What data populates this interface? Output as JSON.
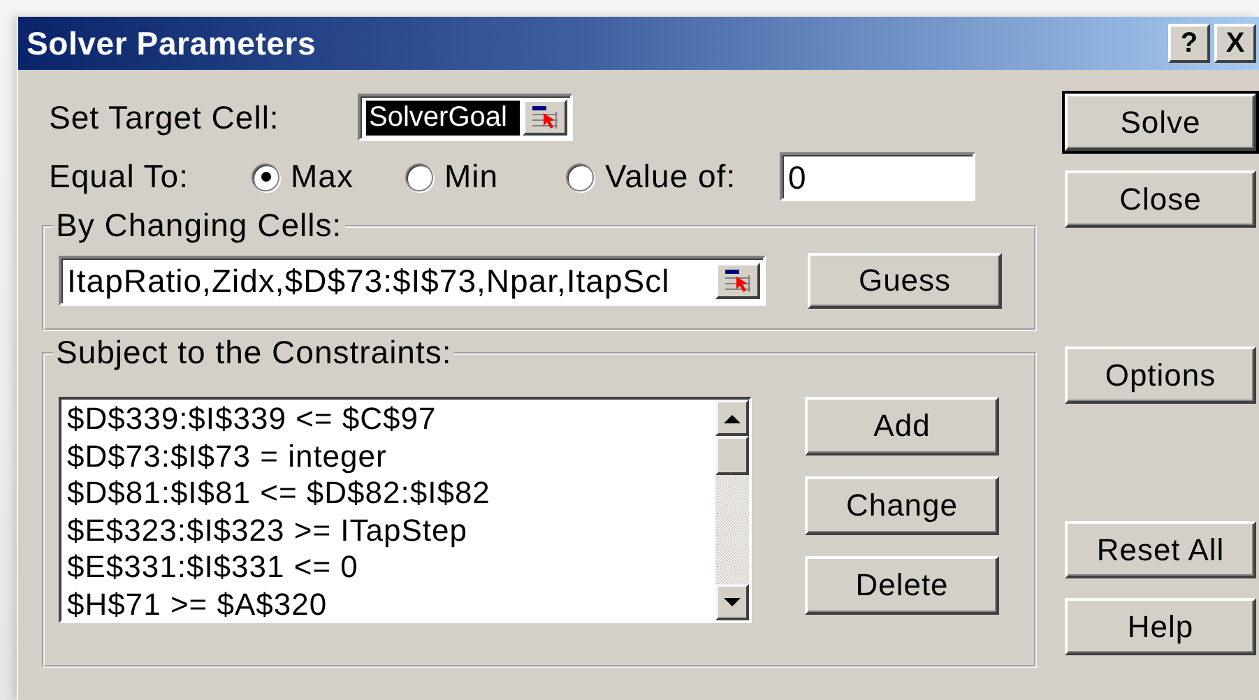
{
  "window": {
    "title": "Solver Parameters",
    "title_buttons": [
      "?",
      "X"
    ]
  },
  "target_cell": {
    "label": "Set Target Cell:",
    "value": "SolverGoal",
    "highlighted": true
  },
  "equal_to": {
    "label": "Equal To:",
    "options": [
      {
        "label": "Max",
        "selected": true
      },
      {
        "label": "Min",
        "selected": false
      },
      {
        "label": "Value of:",
        "selected": false
      }
    ],
    "value": "0"
  },
  "changing_cells": {
    "label": "By Changing Cells:",
    "value": "ItapRatio,Zidx,$D$73:$I$73,Npar,ItapScl",
    "button": {
      "label": "Guess"
    }
  },
  "constraints": {
    "label": "Subject to the Constraints:",
    "items": [
      "$D$339:$I$339 <= $C$97",
      "$D$73:$I$73 = integer",
      "$D$81:$I$81 <= $D$82:$I$82",
      "$E$323:$I$323 >= ITapStep",
      "$E$331:$I$331 <= 0",
      "$H$71 >= $A$320"
    ],
    "buttons": [
      {
        "label": "Add"
      },
      {
        "label": "Change"
      },
      {
        "label": "Delete"
      }
    ]
  },
  "side_buttons": [
    {
      "label": "Solve",
      "default": true
    },
    {
      "label": "Close",
      "default": false
    },
    {
      "label": "Options",
      "default": false
    },
    {
      "label": "Reset All",
      "default": false
    },
    {
      "label": "Help",
      "default": false
    }
  ]
}
